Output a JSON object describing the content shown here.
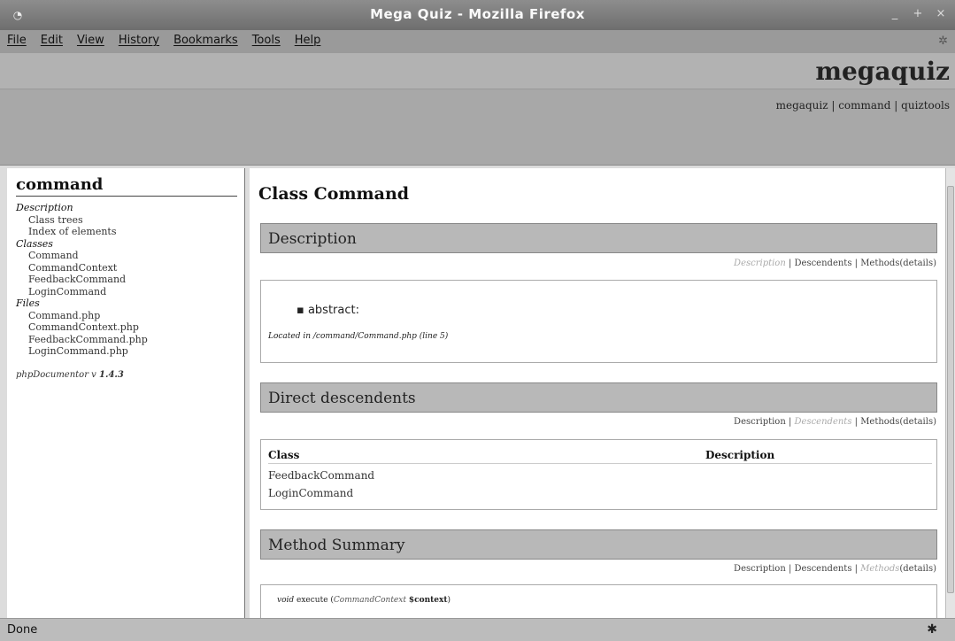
{
  "window": {
    "title": "Mega Quiz - Mozilla Firefox",
    "icon": "firefox-icon",
    "controls": [
      "_",
      "+",
      "×"
    ]
  },
  "menu": {
    "items": [
      "File",
      "Edit",
      "View",
      "History",
      "Bookmarks",
      "Tools",
      "Help"
    ]
  },
  "header": {
    "brand": "megaquiz",
    "links": [
      "megaquiz",
      "command",
      "quiztools"
    ],
    "links_text": "megaquiz | command | quiztools"
  },
  "left_nav": {
    "package": "command",
    "sections": [
      {
        "title": "Description",
        "items": [
          "Class trees",
          "Index of elements"
        ]
      },
      {
        "title": "Classes",
        "items": [
          "Command",
          "CommandContext",
          "FeedbackCommand",
          "LoginCommand"
        ]
      },
      {
        "title": "Files",
        "items": [
          "Command.php",
          "CommandContext.php",
          "FeedbackCommand.php",
          "LoginCommand.php"
        ]
      }
    ],
    "generator_label": "phpDocumentor v",
    "generator_version": "1.4.3"
  },
  "content": {
    "class_title": "Class Command",
    "sections": {
      "description": {
        "title": "Description",
        "nav": [
          "Description",
          "Descendents",
          "Methods",
          "(details)"
        ],
        "bullet": "abstract:",
        "located": "Located in /command/Command.php (line 5)"
      },
      "descendents": {
        "title": "Direct descendents",
        "nav": [
          "Description",
          "Descendents",
          "Methods",
          "(details)"
        ],
        "col_class": "Class",
        "col_description": "Description",
        "rows": [
          "FeedbackCommand",
          "LoginCommand"
        ]
      },
      "methods": {
        "title": "Method Summary",
        "nav": [
          "Description",
          "Descendents",
          "Methods",
          "(details)"
        ],
        "signature_kw": "void",
        "signature_name": "execute",
        "signature_type": "CommandContext",
        "signature_param": "$context"
      }
    }
  },
  "status": {
    "text": "Done",
    "icon": "bug-icon"
  }
}
